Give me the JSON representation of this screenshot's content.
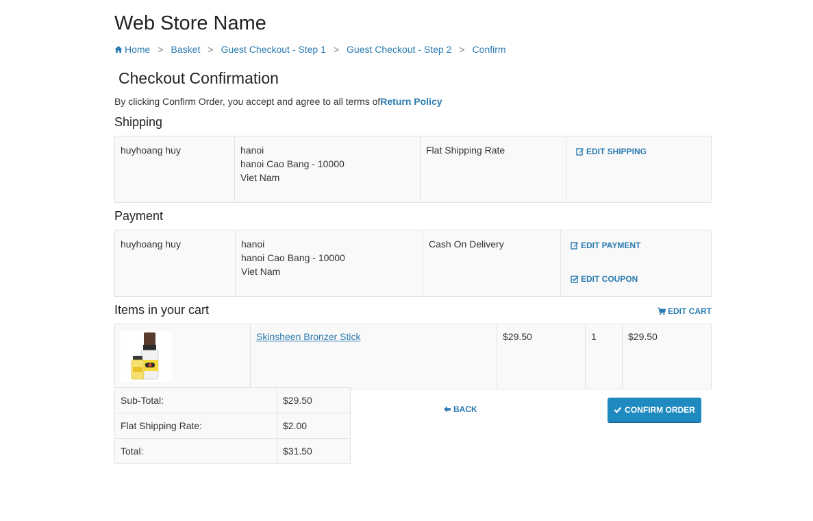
{
  "store": {
    "name": "Web Store Name"
  },
  "breadcrumb": {
    "items": [
      "Home",
      "Basket",
      "Guest Checkout - Step 1",
      "Guest Checkout - Step 2",
      "Confirm"
    ],
    "separator": ">"
  },
  "page": {
    "title": "Checkout Confirmation",
    "terms_text": "By clicking Confirm Order, you accept and agree to all terms of",
    "terms_link": "Return Policy"
  },
  "shipping": {
    "heading": "Shipping",
    "name": "huyhoang huy",
    "address_line1": "hanoi",
    "address_line2": "hanoi Cao Bang - 10000",
    "country": "Viet Nam",
    "method": "Flat Shipping Rate",
    "edit_label": "EDIT SHIPPING"
  },
  "payment": {
    "heading": "Payment",
    "name": "huyhoang huy",
    "address_line1": "hanoi",
    "address_line2": "hanoi Cao Bang - 10000",
    "country": "Viet Nam",
    "method": "Cash On Delivery",
    "edit_payment_label": "EDIT PAYMENT",
    "edit_coupon_label": "EDIT COUPON"
  },
  "cart": {
    "heading": "Items in your cart",
    "edit_label": "EDIT CART",
    "items": [
      {
        "name": "Skinsheen Bronzer Stick",
        "price": "$29.50",
        "quantity": "1",
        "total": "$29.50"
      }
    ]
  },
  "totals": {
    "rows": [
      {
        "label": "Sub-Total:",
        "value": "$29.50"
      },
      {
        "label": "Flat Shipping Rate:",
        "value": "$2.00"
      },
      {
        "label": "Total:",
        "value": "$31.50"
      }
    ]
  },
  "actions": {
    "back_label": "BACK",
    "confirm_label": "CONFIRM ORDER"
  },
  "colors": {
    "link": "#2a7ab0",
    "button": "#1f8ac0",
    "table_bg": "#f9f9f9"
  }
}
